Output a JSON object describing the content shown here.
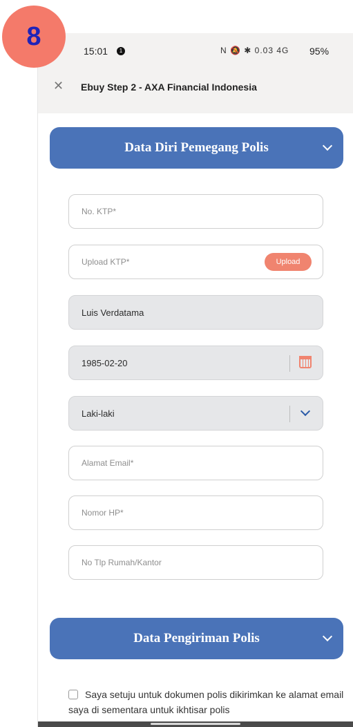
{
  "step": "8",
  "status": {
    "time": "15:01",
    "notification_count": "1",
    "icons": "N 🔕 ✱ 0.03 4G",
    "battery": "95%"
  },
  "window": {
    "title": "Ebuy Step 2 - AXA Financial Indonesia"
  },
  "section1": {
    "title": "Data Diri Pemegang Polis"
  },
  "form": {
    "ktp": {
      "placeholder": "No. KTP*"
    },
    "upload": {
      "placeholder": "Upload KTP*",
      "button": "Upload"
    },
    "name": {
      "value": "Luis Verdatama"
    },
    "dob": {
      "value": "1985-02-20"
    },
    "gender": {
      "value": "Laki-laki"
    },
    "email": {
      "placeholder": "Alamat Email*"
    },
    "phone": {
      "placeholder": "Nomor HP*"
    },
    "home_phone": {
      "placeholder": "No Tlp Rumah/Kantor"
    }
  },
  "section2": {
    "title": "Data Pengiriman Polis"
  },
  "consent": {
    "text": "Saya setuju untuk dokumen polis dikirimkan ke alamat email saya di sementara untuk ikhtisar polis"
  },
  "colors": {
    "accent_blue": "#4a73b8",
    "accent_orange": "#f0846f",
    "badge": "#f47a6a"
  }
}
